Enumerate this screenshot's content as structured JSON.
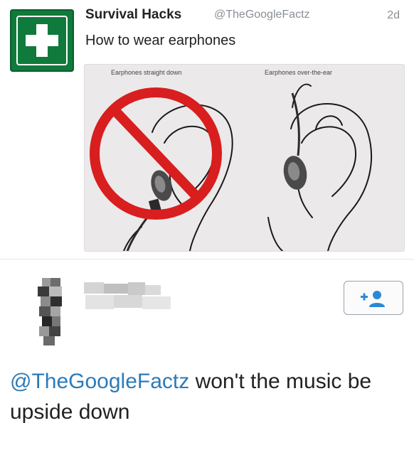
{
  "tweet": {
    "display_name": "Survival Hacks",
    "handle": "@TheGoogleFactz",
    "time": "2d",
    "text": "How to wear earphones",
    "avatar_icon": "first-aid-cross-icon",
    "media": {
      "caption_left": "Earphones straight down",
      "caption_right": "Earphones over-the-ear"
    }
  },
  "reply": {
    "mention": "@TheGoogleFactz",
    "text": " won't the music be upside down",
    "follow_icon": "add-user-icon"
  },
  "colors": {
    "avatar_green": "#0f7a3b",
    "link_blue": "#2b7bb9",
    "follow_blue": "#2b8ad8",
    "prohibit_red": "#d81e1e"
  }
}
